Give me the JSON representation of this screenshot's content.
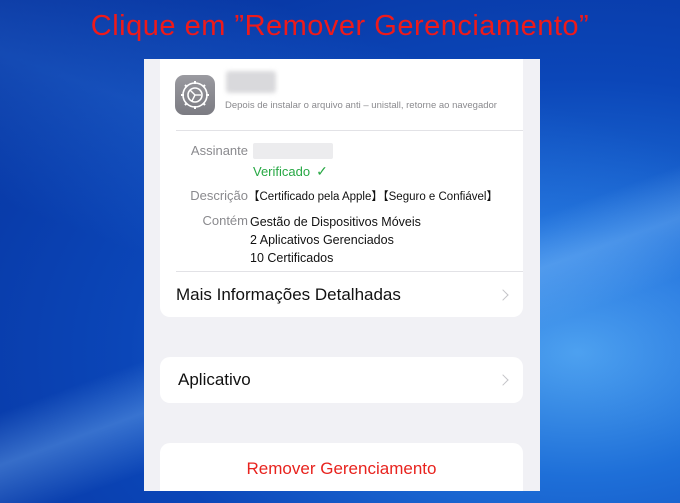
{
  "headline": "Clique em ”Remover Gerenciamento”",
  "profile": {
    "icon": "settings-gear-icon",
    "subtitle": "Depois de instalar o arquivo anti – unistall, retorne ao navegador",
    "assinante_label": "Assinante",
    "verified_text": "Verificado",
    "verified_check": "✓",
    "descricao_label": "Descrição",
    "descricao_value": "【Certificado pela Apple】【Seguro e Confiável】",
    "contem_label": "Contém",
    "contem_items": [
      "Gestão de Dispositivos Móveis",
      "2 Aplicativos Gerenciados",
      "10 Certificados"
    ],
    "more_info_label": "Mais Informações Detalhadas"
  },
  "app_row": {
    "label": "Aplicativo"
  },
  "remove_button": {
    "label": "Remover Gerenciamento"
  },
  "colors": {
    "headline": "#ef1a1a",
    "verified": "#27a844",
    "destructive": "#e8231e"
  }
}
